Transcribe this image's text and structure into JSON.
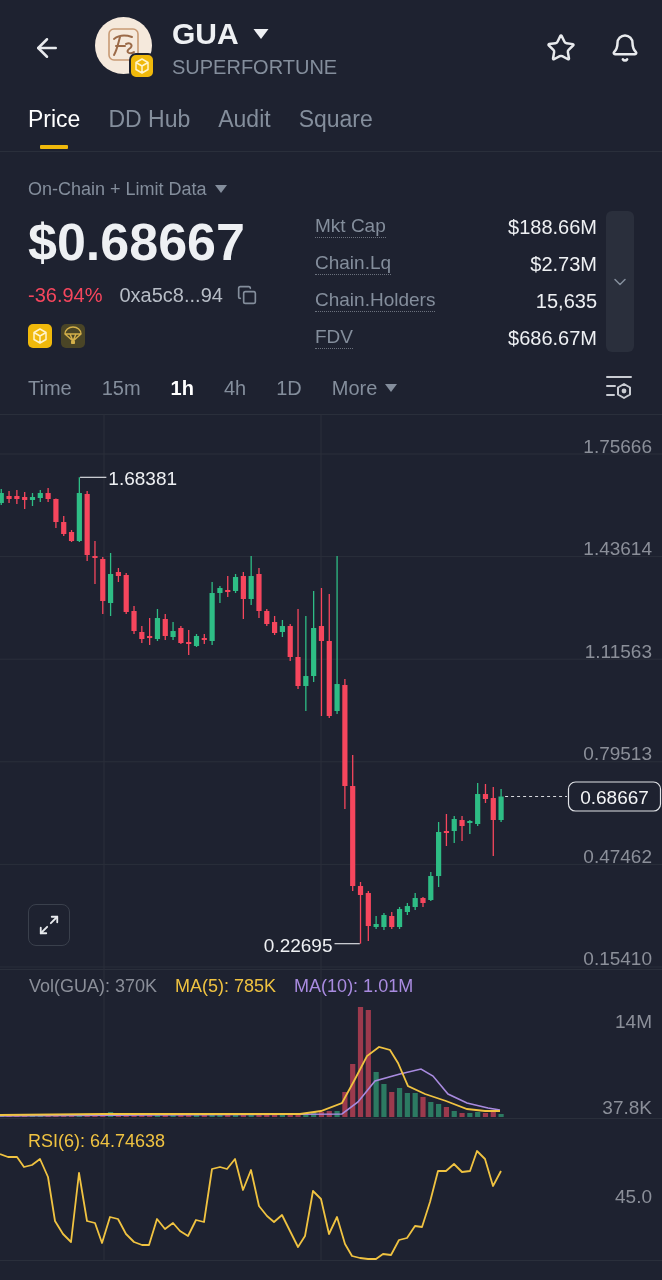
{
  "header": {
    "symbol": "GUA",
    "name": "SUPERFORTUNE"
  },
  "tabs": [
    {
      "label": "Price",
      "selected": true
    },
    {
      "label": "DD Hub",
      "selected": false
    },
    {
      "label": "Audit",
      "selected": false
    },
    {
      "label": "Square",
      "selected": false
    }
  ],
  "summary": {
    "data_source": "On-Chain + Limit Data",
    "price": "$0.68667",
    "change": "-36.94%",
    "contract": "0xa5c8...94"
  },
  "stats": [
    {
      "label": "Mkt Cap",
      "value": "$188.66M"
    },
    {
      "label": "Chain.Lq",
      "value": "$2.73M"
    },
    {
      "label": "Chain.Holders",
      "value": "15,635"
    },
    {
      "label": "FDV",
      "value": "$686.67M"
    }
  ],
  "timeframes": [
    {
      "label": "Time",
      "kind": "option",
      "selected": false
    },
    {
      "label": "15m",
      "kind": "option",
      "selected": false
    },
    {
      "label": "1h",
      "kind": "option",
      "selected": true
    },
    {
      "label": "4h",
      "kind": "option",
      "selected": false
    },
    {
      "label": "1D",
      "kind": "option",
      "selected": false
    },
    {
      "label": "More",
      "kind": "dropdown",
      "selected": false
    }
  ],
  "price_chart": {
    "chart_data": {
      "type": "candlestick",
      "ohlc": [
        [
          1.6036,
          1.6473,
          1.5973,
          1.6348
        ],
        [
          1.6255,
          1.6411,
          1.6036,
          1.6161
        ],
        [
          1.6255,
          1.6442,
          1.6005,
          1.6161
        ],
        [
          1.6223,
          1.6379,
          1.5848,
          1.613
        ],
        [
          1.613,
          1.6348,
          1.5942,
          1.6223
        ],
        [
          1.6192,
          1.6442,
          1.6067,
          1.6348
        ],
        [
          1.6348,
          1.6504,
          1.6067,
          1.6161
        ],
        [
          1.6161,
          1.618,
          1.5255,
          1.5442
        ],
        [
          1.5442,
          1.563,
          1.5005,
          1.5067
        ],
        [
          1.513,
          1.5192,
          1.4817,
          1.4849
        ],
        [
          1.4849,
          1.68381,
          1.4817,
          1.6348
        ],
        [
          1.6317,
          1.6411,
          1.4224,
          1.4411
        ],
        [
          1.438,
          1.4849,
          1.3505,
          1.4318
        ],
        [
          1.4286,
          1.4349,
          1.2568,
          1.2974
        ],
        [
          1.2912,
          1.4474,
          1.2506,
          1.3818
        ],
        [
          1.388,
          1.4005,
          1.3568,
          1.3755
        ],
        [
          1.3787,
          1.3849,
          1.2568,
          1.2631
        ],
        [
          1.2662,
          1.2818,
          1.1943,
          1.2037
        ],
        [
          1.2006,
          1.2193,
          1.1662,
          1.1787
        ],
        [
          1.1881,
          1.2443,
          1.16,
          1.1818
        ],
        [
          1.1787,
          1.2724,
          1.1725,
          1.2443
        ],
        [
          1.2412,
          1.2568,
          1.1756,
          1.1881
        ],
        [
          1.185,
          1.2318,
          1.1756,
          1.2037
        ],
        [
          1.2131,
          1.2193,
          1.1631,
          1.1662
        ],
        [
          1.1693,
          1.2068,
          1.1287,
          1.1631
        ],
        [
          1.1569,
          1.1943,
          1.1537,
          1.1881
        ],
        [
          1.1818,
          1.1943,
          1.1631,
          1.1756
        ],
        [
          1.1725,
          1.3568,
          1.16,
          1.3224
        ],
        [
          1.3224,
          1.3443,
          1.2912,
          1.338
        ],
        [
          1.3318,
          1.3755,
          1.3099,
          1.3255
        ],
        [
          1.3287,
          1.3818,
          1.3224,
          1.3724
        ],
        [
          1.3755,
          1.388,
          1.2412,
          1.3037
        ],
        [
          1.3037,
          1.438,
          1.2849,
          1.3755
        ],
        [
          1.3818,
          1.4005,
          1.2443,
          1.2662
        ],
        [
          1.2662,
          1.2724,
          1.2193,
          1.2256
        ],
        [
          1.2318,
          1.2506,
          1.1912,
          1.1975
        ],
        [
          1.2006,
          1.2381,
          1.185,
          1.2193
        ],
        [
          1.2193,
          1.2256,
          1.11,
          1.1225
        ],
        [
          1.1225,
          1.2724,
          1.0225,
          1.0319
        ],
        [
          1.0319,
          1.2506,
          0.9538,
          1.0631
        ],
        [
          1.0631,
          1.3287,
          1.0444,
          1.2131
        ],
        [
          1.2193,
          1.338,
          0.9382,
          1.1725
        ],
        [
          1.1725,
          1.3193,
          0.9319,
          0.9382
        ],
        [
          0.9538,
          1.438,
          0.9444,
          1.0381
        ],
        [
          1.035,
          1.0538,
          0.6476,
          0.7195
        ],
        [
          0.7195,
          0.8163,
          0.3915,
          0.4071
        ],
        [
          0.4071,
          0.4196,
          0.22695,
          0.379
        ],
        [
          0.3852,
          0.3915,
          0.2353,
          0.2821
        ],
        [
          0.279,
          0.3134,
          0.2728,
          0.2884
        ],
        [
          0.279,
          0.3227,
          0.2696,
          0.3165
        ],
        [
          0.3134,
          0.3259,
          0.2728,
          0.279
        ],
        [
          0.279,
          0.3415,
          0.2728,
          0.3352
        ],
        [
          0.3259,
          0.354,
          0.3165,
          0.3446
        ],
        [
          0.3415,
          0.3852,
          0.3321,
          0.3696
        ],
        [
          0.3696,
          0.3727,
          0.3415,
          0.354
        ],
        [
          0.3634,
          0.4508,
          0.3602,
          0.4383
        ],
        [
          0.4383,
          0.607,
          0.404,
          0.5758
        ],
        [
          0.5789,
          0.632,
          0.5321,
          0.5727
        ],
        [
          0.5789,
          0.6258,
          0.5414,
          0.6164
        ],
        [
          0.6133,
          0.6258,
          0.5477,
          0.5945
        ],
        [
          0.6039,
          0.6133,
          0.5695,
          0.6102
        ],
        [
          0.6008,
          0.7289,
          0.5945,
          0.6945
        ],
        [
          0.6945,
          0.7257,
          0.6664,
          0.6789
        ],
        [
          0.682,
          0.7164,
          0.5008,
          0.6133
        ],
        [
          0.6133,
          0.7101,
          0.607,
          0.68667
        ]
      ],
      "ylim": [
        0.14785,
        1.88162
      ],
      "yticks": [
        1.75666,
        1.43614,
        1.11563,
        0.79513,
        0.47462,
        {
          "value": 0.1541,
          "label": "0.15410"
        }
      ],
      "grid": true,
      "annotations": [
        "1.68381",
        "0.22695",
        "0.68667"
      ]
    }
  },
  "volume_panel": {
    "legend": [
      {
        "text": "Vol(GUA): 370K",
        "color": "#8b8f99"
      },
      {
        "text": "MA(5): 785K",
        "color": "#f0c341"
      },
      {
        "text": "MA(10): 1.01M",
        "color": "#a98be0"
      }
    ],
    "axis_labels": [
      "14M",
      "37.8K"
    ]
  },
  "rsi_panel": {
    "label": "RSI(6): 64.74638",
    "axis_labels": [
      "45.0"
    ]
  }
}
